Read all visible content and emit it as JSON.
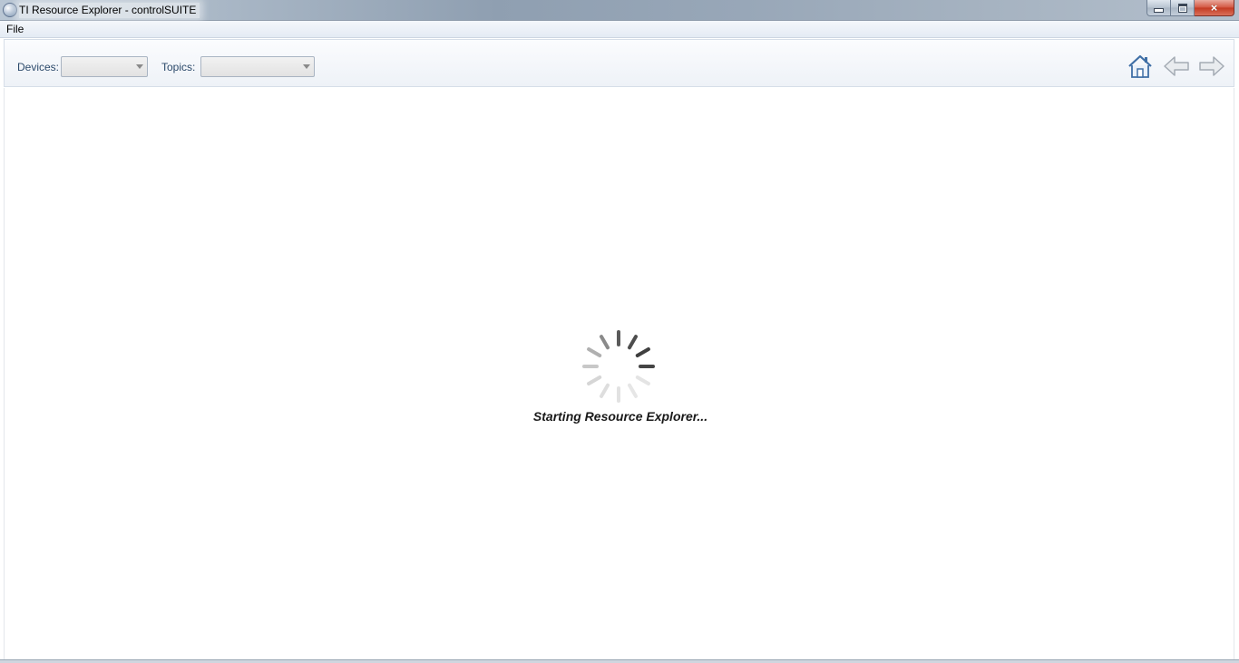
{
  "window": {
    "title": "TI Resource Explorer - controlSUITE",
    "controls": {
      "minimize": "minimize",
      "maximize": "restore",
      "close": "×"
    }
  },
  "menu": {
    "items": [
      "File"
    ]
  },
  "toolbar": {
    "devices_label": "Devices:",
    "devices_value": "",
    "topics_label": "Topics:",
    "topics_value": "",
    "icons": [
      "home-icon",
      "back-arrow-icon",
      "forward-arrow-icon"
    ]
  },
  "main": {
    "loading_text": "Starting Resource Explorer...",
    "spinner_icon": "loading-spinner-icon"
  },
  "colors": {
    "accent_text": "#2c4a6b",
    "close_button": "#c33a21",
    "home_icon": "#3f6fa6",
    "spinner_dark": "#555555",
    "spinner_light": "#e6e6e6"
  }
}
